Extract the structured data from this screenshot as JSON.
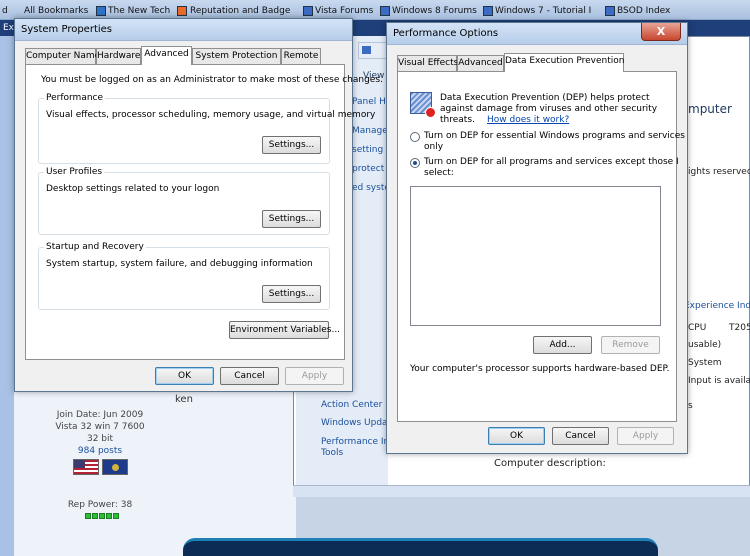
{
  "browser": {
    "bookmarks": [
      {
        "label": "d"
      },
      {
        "label": "All Bookmarks"
      },
      {
        "label": "The New Tech"
      },
      {
        "label": "Reputation and Badge"
      },
      {
        "label": "Vista Forums"
      },
      {
        "label": "Windows 8 Forums"
      },
      {
        "label": "Windows 7 - Tutorial I"
      },
      {
        "label": "BSOD Index"
      }
    ],
    "tab_label": "Ex"
  },
  "forum": {
    "username": "ken",
    "join_date": "Join Date: Jun 2009",
    "system": "Vista 32 win 7 7600",
    "bits": "32 bit",
    "posts": "984 posts",
    "rep_power": "Rep Power: 38"
  },
  "control_panel": {
    "sidebar_links": [
      "View",
      "Panel H",
      "Manage",
      "setting",
      "protect",
      "ed syste"
    ],
    "bottom_links": [
      "Action Center",
      "Windows Upda",
      "Performance In",
      "Tools"
    ],
    "right_texts": [
      "mputer",
      "ights reserved.",
      "Experience Inde",
      "CPU",
      "T205",
      "usable)",
      "System",
      "Input is availab",
      "s"
    ],
    "computer_description": "Computer description:"
  },
  "system_properties": {
    "title": "System Properties",
    "tabs": [
      "Computer Name",
      "Hardware",
      "Advanced",
      "System Protection",
      "Remote"
    ],
    "admin_note": "You must be logged on as an Administrator to make most of these changes.",
    "performance": {
      "label": "Performance",
      "desc": "Visual effects, processor scheduling, memory usage, and virtual memory",
      "button": "Settings..."
    },
    "user_profiles": {
      "label": "User Profiles",
      "desc": "Desktop settings related to your logon",
      "button": "Settings..."
    },
    "startup_recovery": {
      "label": "Startup and Recovery",
      "desc": "System startup, system failure, and debugging information",
      "button": "Settings..."
    },
    "env_button": "Environment Variables...",
    "ok": "OK",
    "cancel": "Cancel",
    "apply": "Apply"
  },
  "performance_options": {
    "title": "Performance Options",
    "close": "X",
    "tabs": [
      "Visual Effects",
      "Advanced",
      "Data Execution Prevention"
    ],
    "intro": "Data Execution Prevention (DEP) helps protect",
    "intro2": "against damage from viruses and other security",
    "intro3": "threats.",
    "help_link": "How does it work?",
    "option1_line1": "Turn on DEP for essential Windows programs and services",
    "option1_line2": "only",
    "option2_line1": "Turn on DEP for all programs and services except those I",
    "option2_line2": "select:",
    "add": "Add...",
    "remove": "Remove",
    "support_note": "Your computer's processor supports hardware-based DEP.",
    "ok": "OK",
    "cancel": "Cancel",
    "apply": "Apply"
  },
  "colors": {
    "accent": "#3c7fb1",
    "link": "#1a4f9c",
    "rep_green": "#2fbe3a"
  }
}
